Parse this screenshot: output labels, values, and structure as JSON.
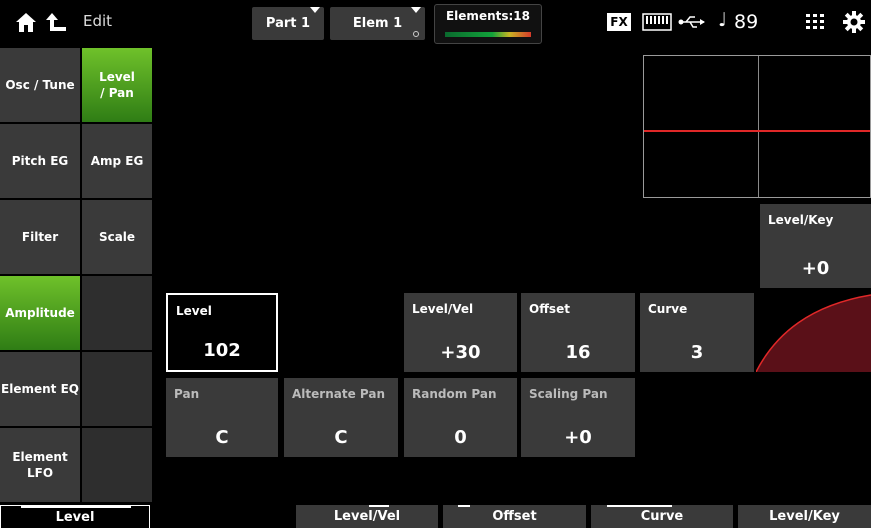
{
  "header": {
    "edit_label": "Edit",
    "part_tab": "Part 1",
    "elem_tab": "Elem 1",
    "elements_label": "Elements:18",
    "fx_label": "FX",
    "tempo": "89",
    "note_glyph": "♩"
  },
  "left_nav": [
    {
      "label": "Osc / Tune",
      "active": false
    },
    {
      "label": "Pitch EG",
      "active": false
    },
    {
      "label": "Filter",
      "active": false
    },
    {
      "label": "Amplitude",
      "active": true
    },
    {
      "label": "Element EQ",
      "active": false
    },
    {
      "label": "Element\nLFO",
      "active": false
    }
  ],
  "sub_nav": [
    {
      "label": "Level\n/ Pan",
      "active": true
    },
    {
      "label": "Amp EG",
      "active": false
    },
    {
      "label": "Scale",
      "active": false
    }
  ],
  "params": {
    "level_key": {
      "label": "Level/Key",
      "value": "+0"
    },
    "level": {
      "label": "Level",
      "value": "102"
    },
    "level_vel": {
      "label": "Level/Vel",
      "value": "+30"
    },
    "offset": {
      "label": "Offset",
      "value": "16"
    },
    "curve": {
      "label": "Curve",
      "value": "3"
    },
    "pan": {
      "label": "Pan",
      "value": "C"
    },
    "alternate_pan": {
      "label": "Alternate Pan",
      "value": "C"
    },
    "random_pan": {
      "label": "Random Pan",
      "value": "0"
    },
    "scaling_pan": {
      "label": "Scaling Pan",
      "value": "+0"
    }
  },
  "bottom_bar": {
    "level": "Level",
    "level_vel": "Level/Vel",
    "offset": "Offset",
    "curve": "Curve",
    "level_key": "Level/Key"
  },
  "colors": {
    "accent_green": "#6fc12a",
    "graph_red": "#e02828",
    "tile_bg": "#3a3a3a"
  }
}
